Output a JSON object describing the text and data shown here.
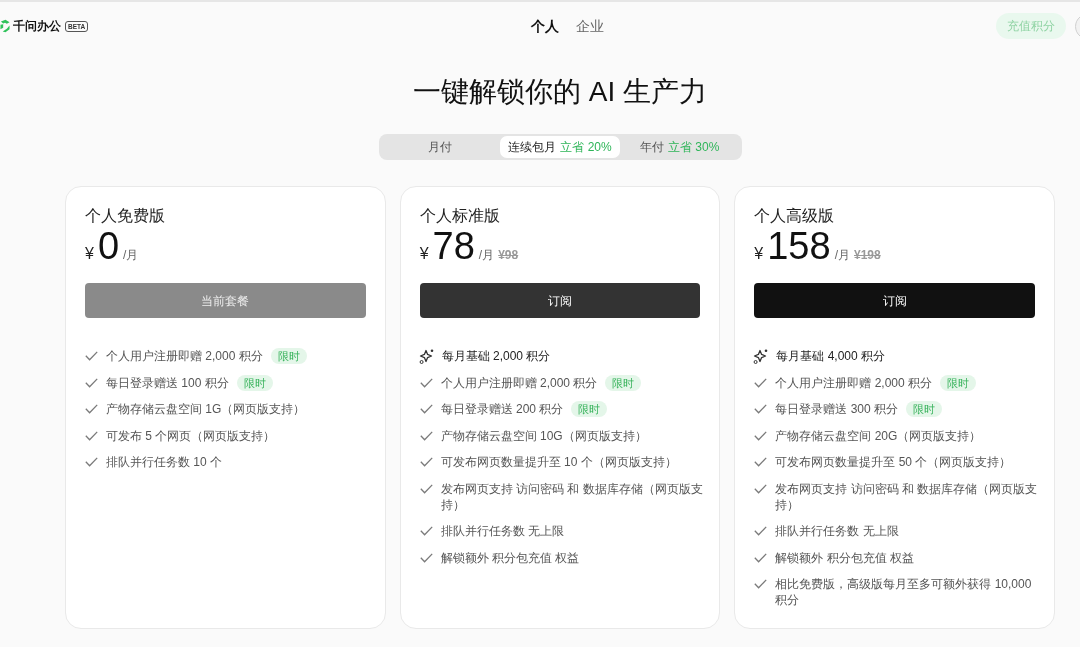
{
  "header": {
    "logo": {
      "name": "千问办公",
      "badge": "BETA"
    },
    "tabs": [
      {
        "label": "个人",
        "selected": true
      },
      {
        "label": "企业",
        "selected": false
      }
    ],
    "recharge_button": "充值积分"
  },
  "title": "一键解锁你的 AI 生产力",
  "billing_options": [
    {
      "label": "月付",
      "selected": false
    },
    {
      "label": "连续包月",
      "discount": "立省 20%",
      "selected": true
    },
    {
      "label": "年付",
      "discount": "立省 30%",
      "selected": false
    }
  ],
  "plans": [
    {
      "name": "个人免费版",
      "price": {
        "currency": "¥",
        "amount": "0",
        "period": "/月"
      },
      "button": {
        "label": "当前套餐",
        "disabled": true,
        "hovered": false
      },
      "features": [
        {
          "kind": "check",
          "text": "个人用户注册即赠 2,000 积分",
          "badge": "限时"
        },
        {
          "kind": "check",
          "text": "每日登录赠送 100 积分",
          "badge": "限时"
        },
        {
          "kind": "check",
          "text": "产物存储云盘空间 1G（网页版支持）"
        },
        {
          "kind": "check",
          "text": "可发布 5 个网页（网页版支持）"
        },
        {
          "kind": "check",
          "text": "排队并行任务数 10 个"
        }
      ]
    },
    {
      "name": "个人标准版",
      "price": {
        "currency": "¥",
        "amount": "78",
        "period": "/月",
        "original": "¥98"
      },
      "button": {
        "label": "订阅",
        "disabled": false,
        "hovered": false
      },
      "features": [
        {
          "kind": "highlight",
          "text": "每月基础 2,000 积分"
        },
        {
          "kind": "check",
          "text": "个人用户注册即赠 2,000 积分",
          "badge": "限时"
        },
        {
          "kind": "check",
          "text": "每日登录赠送 200 积分",
          "badge": "限时"
        },
        {
          "kind": "check",
          "text": "产物存储云盘空间 10G（网页版支持）"
        },
        {
          "kind": "check",
          "text": "可发布网页数量提升至 10 个（网页版支持）"
        },
        {
          "kind": "check",
          "text": "发布网页支持 访问密码 和 数据库存储（网页版支持）"
        },
        {
          "kind": "check",
          "text": "排队并行任务数 无上限"
        },
        {
          "kind": "check",
          "text": "解锁额外 积分包充值 权益"
        }
      ]
    },
    {
      "name": "个人高级版",
      "price": {
        "currency": "¥",
        "amount": "158",
        "period": "/月",
        "original": "¥198"
      },
      "button": {
        "label": "订阅",
        "disabled": false,
        "hovered": true
      },
      "features": [
        {
          "kind": "highlight",
          "text": "每月基础 4,000 积分"
        },
        {
          "kind": "check",
          "text": "个人用户注册即赠 2,000 积分",
          "badge": "限时"
        },
        {
          "kind": "check",
          "text": "每日登录赠送 300 积分",
          "badge": "限时"
        },
        {
          "kind": "check",
          "text": "产物存储云盘空间 20G（网页版支持）"
        },
        {
          "kind": "check",
          "text": "可发布网页数量提升至 50 个（网页版支持）"
        },
        {
          "kind": "check",
          "text": "发布网页支持 访问密码 和 数据库存储（网页版支持）"
        },
        {
          "kind": "check",
          "text": "排队并行任务数 无上限"
        },
        {
          "kind": "check",
          "text": "解锁额外 积分包充值 权益"
        },
        {
          "kind": "check",
          "text": "相比免费版，高级版每月至多可额外获得 10,000 积分"
        }
      ]
    }
  ]
}
